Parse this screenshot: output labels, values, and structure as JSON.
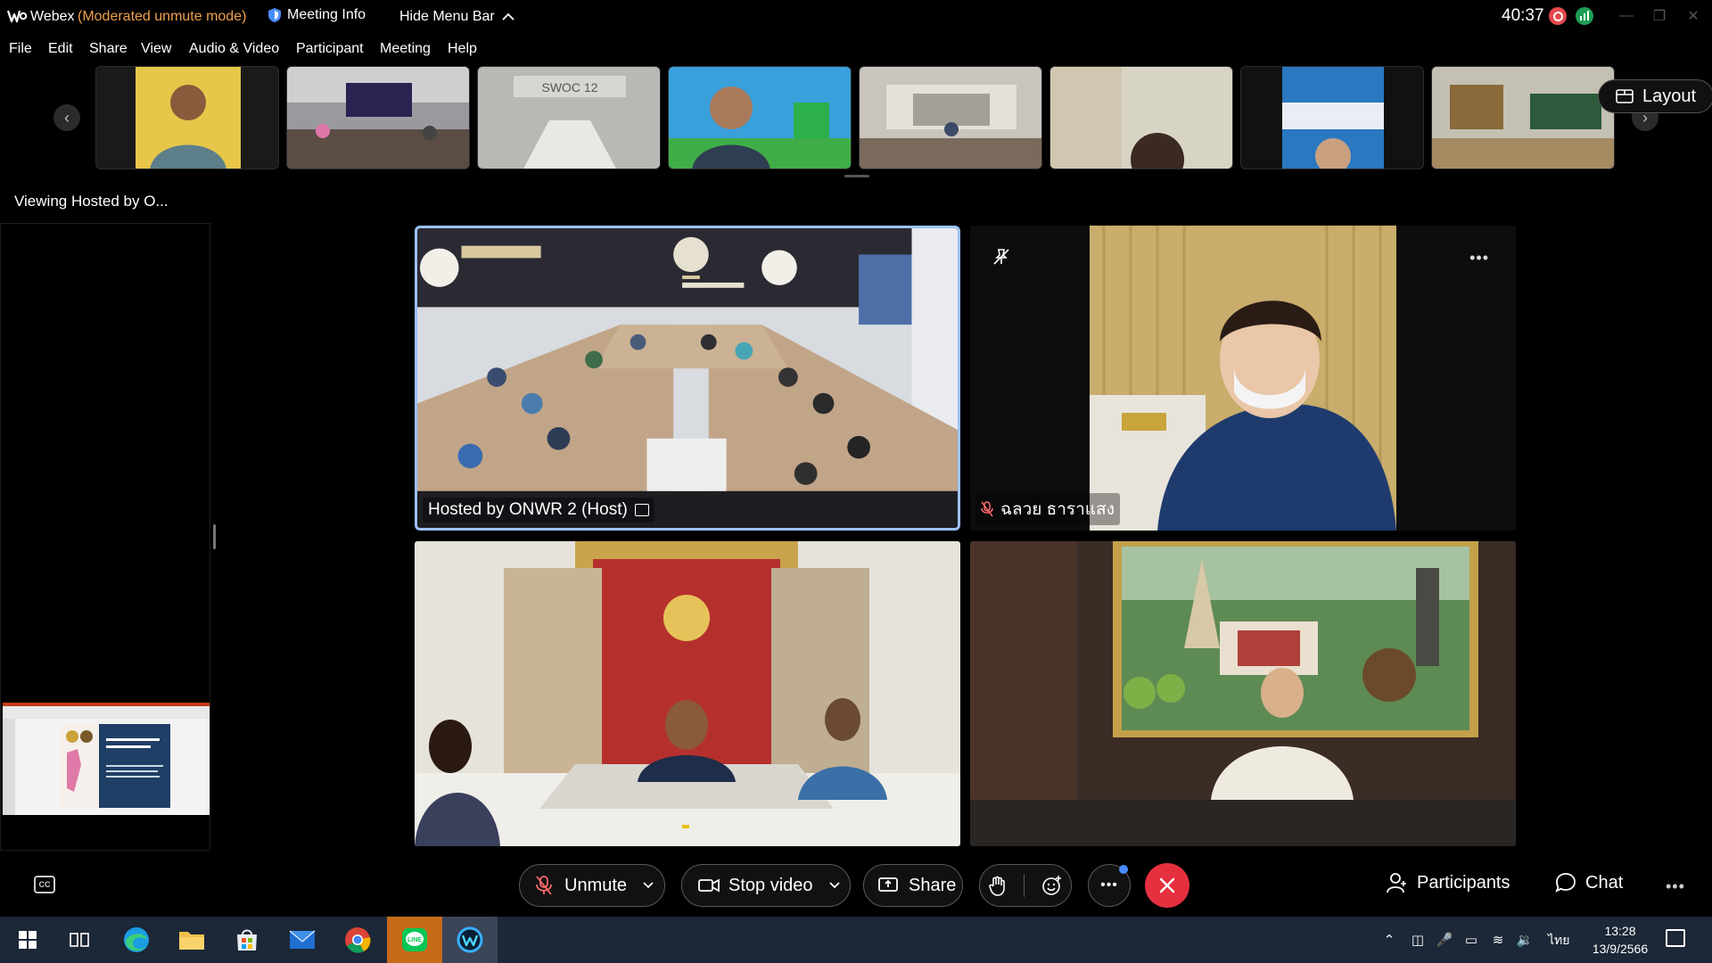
{
  "titlebar": {
    "app_name": "Webex",
    "mode": "(Moderated unmute mode)",
    "meeting_info": "Meeting Info",
    "hide_menu_bar": "Hide Menu Bar",
    "timer": "40:37"
  },
  "menu": {
    "items": [
      "File",
      "Edit",
      "Share",
      "View",
      "Audio & Video",
      "Participant",
      "Meeting",
      "Help"
    ]
  },
  "filmstrip": {
    "layout_label": "Layout",
    "thumbs": [
      "participant-1",
      "participant-2",
      "participant-3",
      "participant-4",
      "participant-5",
      "participant-6",
      "participant-7",
      "participant-8"
    ]
  },
  "left_panel": {
    "viewing_label": "Viewing Hosted by O..."
  },
  "grid": {
    "tiles": [
      {
        "label": "Hosted by ONWR 2 (Host)"
      },
      {
        "label": "ฉลวย ธาราแสง"
      },
      {
        "label": ""
      },
      {
        "label": ""
      }
    ]
  },
  "controls": {
    "unmute": "Unmute",
    "stop_video": "Stop video",
    "share": "Share",
    "participants": "Participants",
    "chat": "Chat"
  },
  "taskbar": {
    "lang": "ไทย",
    "time": "13:28",
    "date": "13/9/2566"
  },
  "colors": {
    "mode_text": "#f0a04b",
    "active_border": "#9cc2ff",
    "end_call": "#e5303f",
    "taskbar": "#1c2737"
  }
}
